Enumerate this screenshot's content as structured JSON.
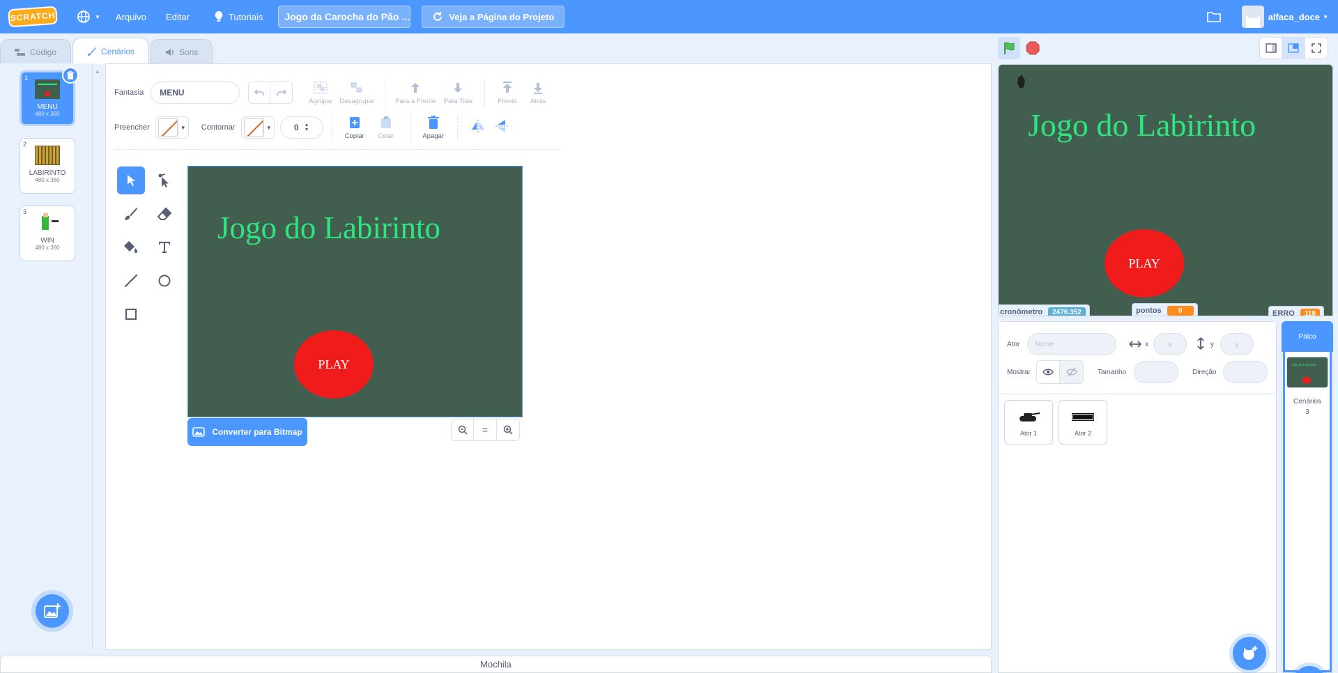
{
  "menubar": {
    "logo": "SCRATCH",
    "file_menu": "Arquivo",
    "edit_menu": "Editar",
    "tutorials": "Tutoriais",
    "project_title": "Jogo da Carocha do Pão ...",
    "see_project_page": "Veja a Página do Projeto",
    "username": "alfaca_doce"
  },
  "tabs": [
    {
      "label": "Código",
      "icon": "code-icon"
    },
    {
      "label": "Cenários",
      "icon": "brush-icon",
      "active": true
    },
    {
      "label": "Sons",
      "icon": "speaker-icon"
    }
  ],
  "costumes": [
    {
      "num": "1",
      "name": "MENU",
      "size": "480 x 360",
      "selected": true
    },
    {
      "num": "2",
      "name": "LABIRINTO",
      "size": "480 x 360"
    },
    {
      "num": "3",
      "name": "WIN",
      "size": "480 x 360"
    }
  ],
  "editor": {
    "costume_label": "Fantasia",
    "costume_name": "MENU",
    "group": "Agrupar",
    "ungroup": "Desagrupar",
    "forward": "Para a Frente",
    "backward": "Para Trás",
    "front": "Frente",
    "back": "Atrás",
    "fill_label": "Preencher",
    "outline_label": "Contornar",
    "outline_width": "0",
    "copy": "Copiar",
    "paste": "Colar",
    "delete": "Apagar",
    "convert_bitmap": "Converter para Bitmap",
    "zoom_reset": "="
  },
  "canvas": {
    "title": "Jogo do Labirinto",
    "play": "PLAY"
  },
  "backpack": "Mochila",
  "stage": {
    "title": "Jogo do Labirinto",
    "play": "PLAY",
    "monitors": [
      {
        "label": "cronômetro",
        "value": "2476.352",
        "color": "#5cb1d6"
      },
      {
        "label": "pontos",
        "value": "0",
        "color": "#ff8c1a"
      },
      {
        "label": "ERRO",
        "value": "118",
        "color": "#ff8c1a"
      }
    ]
  },
  "sprite_info": {
    "sprite_label": "Ator",
    "name_placeholder": "Nome",
    "x_label": "x",
    "x_placeholder": "x",
    "y_label": "y",
    "y_placeholder": "y",
    "show_label": "Mostrar",
    "size_label": "Tamanho",
    "direction_label": "Direção"
  },
  "sprites": [
    {
      "name": "Ator 1"
    },
    {
      "name": "Ator 2"
    }
  ],
  "stage_selector": {
    "title": "Palco",
    "backdrops_label": "Cenários",
    "backdrops_count": "3"
  },
  "colors": {
    "accent": "#4c97ff",
    "scene_bg": "#425e4f",
    "title_green": "#2ee67f",
    "play_red": "#f01c1c"
  }
}
